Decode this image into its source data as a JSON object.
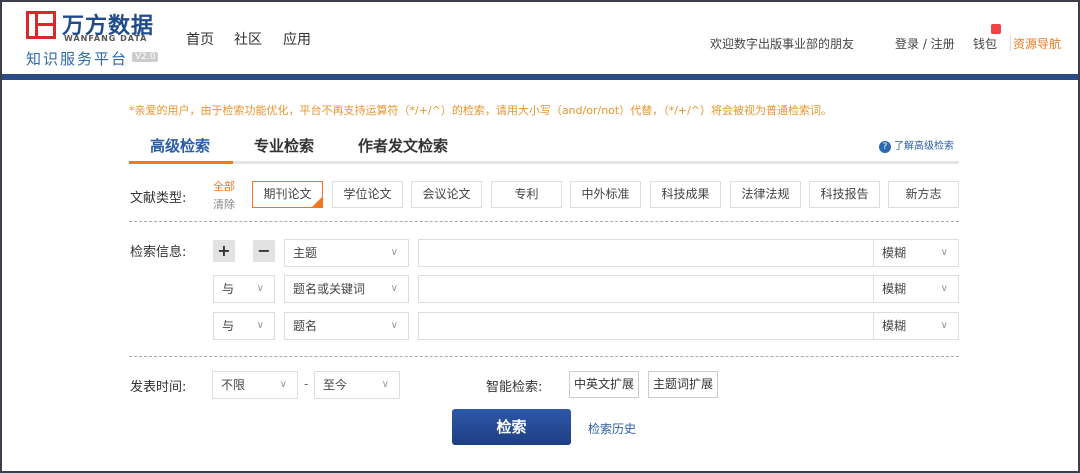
{
  "header": {
    "logo_cn": "万方数据",
    "logo_en": "WANFANG DATA",
    "platform": "知识服务平台",
    "version": "V2.0",
    "nav": [
      "首页",
      "社区",
      "应用"
    ],
    "welcome": "欢迎数字出版事业部的朋友",
    "login": "登录 / 注册",
    "wallet": "钱包",
    "resource_nav": "资源导航"
  },
  "notice": "*亲爱的用户，由于检索功能优化，平台不再支持运算符（*/+/^）的检索，请用大小写（and/or/not）代替，（*/+/^）将会被视为普通检索词。",
  "tabs": [
    "高级检索",
    "专业检索",
    "作者发文检索"
  ],
  "help_link": "了解高级检索",
  "doc_type": {
    "label": "文献类型:",
    "all": "全部",
    "clear": "清除",
    "types": [
      "期刊论文",
      "学位论文",
      "会议论文",
      "专利",
      "中外标准",
      "科技成果",
      "法律法规",
      "科技报告",
      "新方志"
    ],
    "selected": "期刊论文"
  },
  "search_info": {
    "label": "检索信息:",
    "plus": "+",
    "minus": "−",
    "rows": [
      {
        "logic": "",
        "field": "主题",
        "value": "",
        "match": "模糊"
      },
      {
        "logic": "与",
        "field": "题名或关键词",
        "value": "",
        "match": "模糊"
      },
      {
        "logic": "与",
        "field": "题名",
        "value": "",
        "match": "模糊"
      }
    ]
  },
  "time": {
    "label": "发表时间:",
    "from": "不限",
    "dash": "-",
    "to": "至今"
  },
  "smart": {
    "label": "智能检索:",
    "options": [
      "中英文扩展",
      "主题词扩展"
    ]
  },
  "search_button": "检索",
  "history_link": "检索历史",
  "colors": {
    "brand": "#1f4a8c",
    "accent": "#f0781e",
    "notice": "#e8952c"
  }
}
